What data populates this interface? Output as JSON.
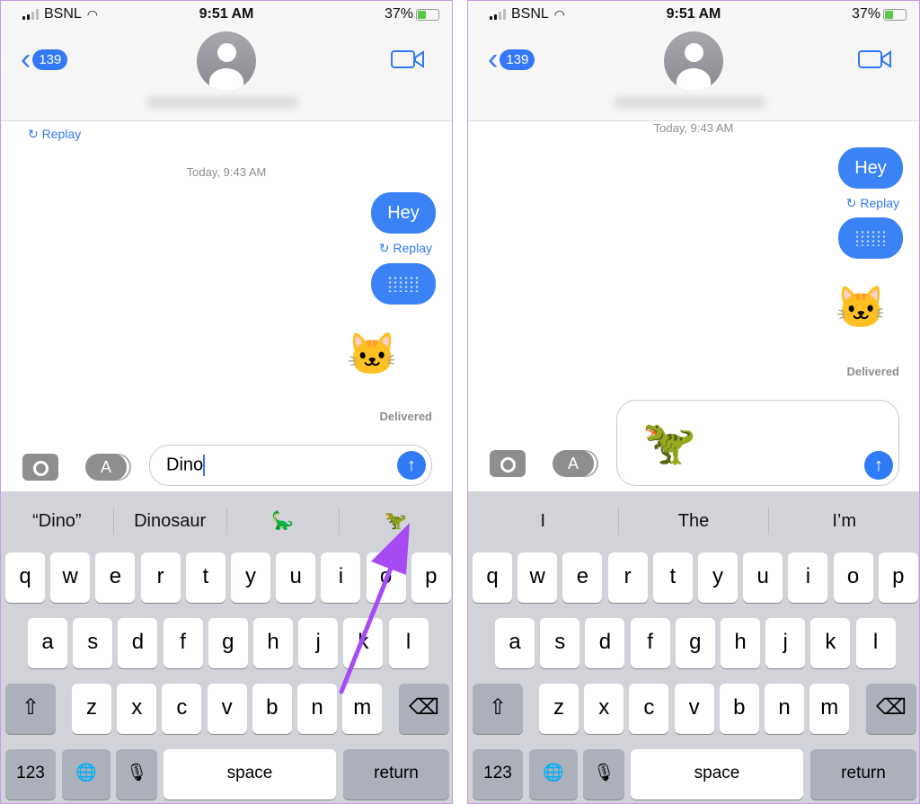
{
  "colors": {
    "accent": "#3478f6",
    "bubble": "#3b82f6",
    "keyboard": "#d1d3d9",
    "annotation": "#a64bf4"
  },
  "screens": [
    {
      "status": {
        "carrier": "BSNL",
        "time": "9:51 AM",
        "battery": "37%"
      },
      "nav": {
        "back_count": "139"
      },
      "messages": {
        "top_replay": "Replay",
        "timestamp": "Today, 9:43 AM",
        "hey": "Hey",
        "replay": "Replay",
        "cat": "🐱",
        "delivered": "Delivered"
      },
      "input": {
        "value": "Dino",
        "send": "↑",
        "apps": "A"
      },
      "suggestions": [
        "“Dino”",
        "Dinosaur",
        "🦕",
        "🦖"
      ]
    },
    {
      "status": {
        "carrier": "BSNL",
        "time": "9:51 AM",
        "battery": "37%"
      },
      "nav": {
        "back_count": "139"
      },
      "messages": {
        "timestamp": "Today, 9:43 AM",
        "hey": "Hey",
        "replay": "Replay",
        "cat": "🐱",
        "delivered": "Delivered"
      },
      "input": {
        "value": "🦖",
        "send": "↑",
        "apps": "A"
      },
      "suggestions": [
        "I",
        "The",
        "I’m"
      ]
    }
  ],
  "keyboard": {
    "row1": [
      "q",
      "w",
      "e",
      "r",
      "t",
      "y",
      "u",
      "i",
      "o",
      "p"
    ],
    "row2": [
      "a",
      "s",
      "d",
      "f",
      "g",
      "h",
      "j",
      "k",
      "l"
    ],
    "row3": [
      "z",
      "x",
      "c",
      "v",
      "b",
      "n",
      "m"
    ],
    "shift": "⇧",
    "delete": "⌫",
    "numbers": "123",
    "globe": "🌐",
    "mic": "🎙",
    "space": "space",
    "return": "return"
  }
}
